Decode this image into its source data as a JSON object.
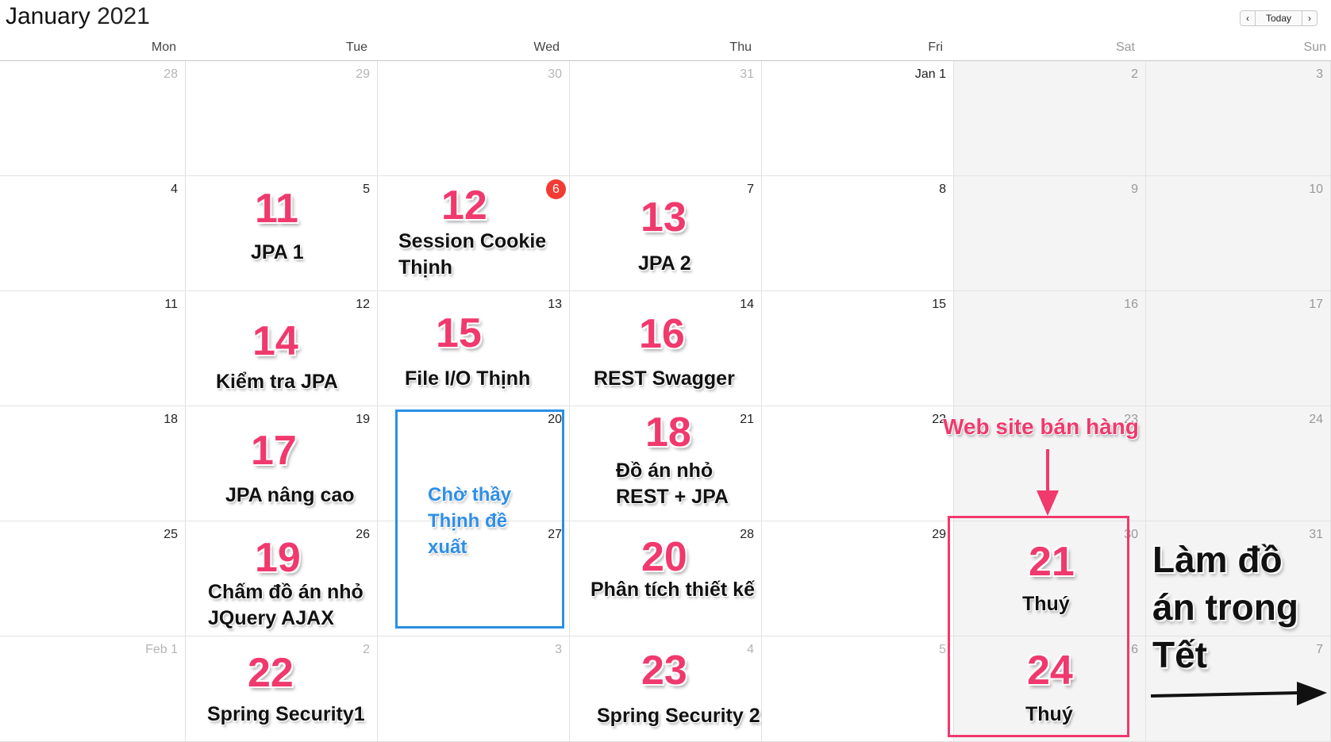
{
  "header": {
    "month": "January",
    "year": "2021"
  },
  "nav": {
    "prev": "‹",
    "today": "Today",
    "next": "›"
  },
  "weekdays": [
    "Mon",
    "Tue",
    "Wed",
    "Thu",
    "Fri",
    "Sat",
    "Sun"
  ],
  "weeks": [
    [
      "28",
      "29",
      "30",
      "31",
      "Jan 1",
      "2",
      "3"
    ],
    [
      "4",
      "5",
      "6",
      "7",
      "8",
      "9",
      "10"
    ],
    [
      "11",
      "12",
      "13",
      "14",
      "15",
      "16",
      "17"
    ],
    [
      "18",
      "19",
      "20",
      "21",
      "22",
      "23",
      "24"
    ],
    [
      "25",
      "26",
      "27",
      "28",
      "29",
      "30",
      "31"
    ],
    [
      "Feb 1",
      "2",
      "3",
      "4",
      "5",
      "6",
      "7"
    ]
  ],
  "today_badge": "6",
  "annotations": {
    "a11": {
      "num": "11",
      "text": "JPA 1"
    },
    "a12": {
      "num": "12",
      "text1": "Session Cookie",
      "text2": "Thịnh"
    },
    "a13": {
      "num": "13",
      "text": "JPA 2"
    },
    "a14": {
      "num": "14",
      "text": "Kiểm tra JPA"
    },
    "a15": {
      "num": "15",
      "text": "File I/O Thịnh"
    },
    "a16": {
      "num": "16",
      "text": "REST Swagger"
    },
    "a17": {
      "num": "17",
      "text": "JPA nâng cao"
    },
    "a18": {
      "num": "18",
      "text1": "Đồ án nhỏ",
      "text2": "REST + JPA"
    },
    "a19": {
      "num": "19",
      "text1": "Chấm đồ án nhỏ",
      "text2": "JQuery AJAX"
    },
    "a20": {
      "num": "20",
      "text": "Phân tích thiết kế"
    },
    "a21": {
      "num": "21",
      "text": "Thuý"
    },
    "a22": {
      "num": "22",
      "text": "Spring Security1"
    },
    "a23": {
      "num": "23",
      "text": "Spring Security 2"
    },
    "a24": {
      "num": "24",
      "text": "Thuý"
    },
    "pending": {
      "line1": "Chờ thầy",
      "line2": "Thịnh đề",
      "line3": "xuất"
    },
    "website": "Web site bán hàng",
    "tet": {
      "line1": "Làm đồ",
      "line2": "án trong",
      "line3": "Tết"
    }
  },
  "colors": {
    "accent_pink": "#f0396d",
    "accent_blue": "#2a8fe5",
    "today_red": "#f33a33"
  }
}
